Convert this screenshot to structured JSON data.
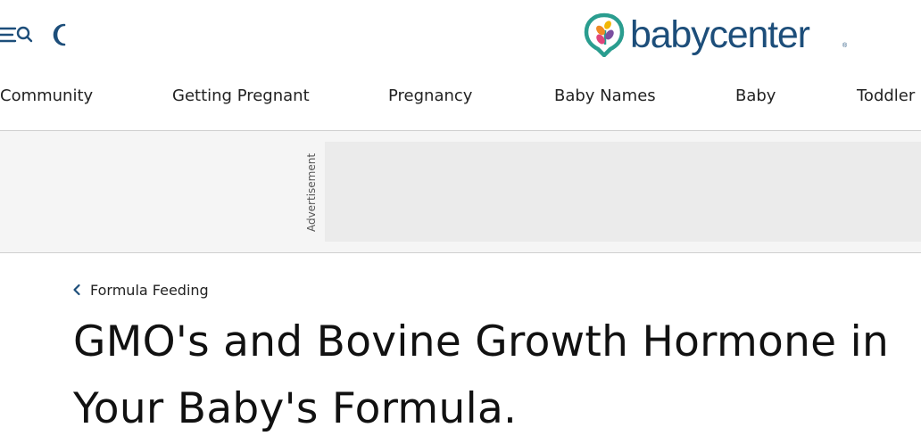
{
  "header": {
    "menu_icon": "menu-search-icon",
    "theme_icon": "moon-icon",
    "logo": {
      "text": "babycenter",
      "colors": {
        "text": "#1d4e7a",
        "teal": "#2a9d8f",
        "orange": "#f08a24",
        "pink": "#e0457b",
        "purple": "#7b4fa0"
      }
    }
  },
  "nav": {
    "items": [
      {
        "label": "Community"
      },
      {
        "label": "Getting Pregnant"
      },
      {
        "label": "Pregnancy"
      },
      {
        "label": "Baby Names"
      },
      {
        "label": "Baby"
      },
      {
        "label": "Toddler"
      }
    ]
  },
  "ad": {
    "label": "Advertisement"
  },
  "breadcrumb": {
    "label": "Formula Feeding",
    "icon": "chevron-left-icon",
    "icon_color": "#1d4e7a"
  },
  "article": {
    "title": "GMO's and Bovine Growth Hormone in Your Baby's Formula."
  }
}
